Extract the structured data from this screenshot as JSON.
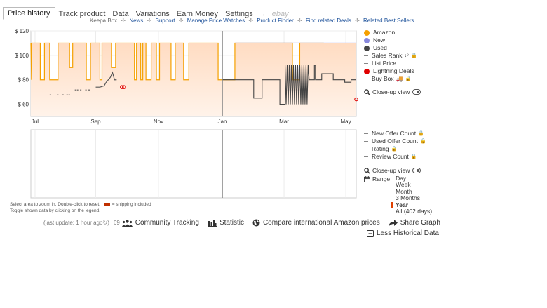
{
  "tabs": [
    "Price history",
    "Track product",
    "Data",
    "Variations",
    "Earn Money",
    "Settings"
  ],
  "tab_arrow": "→",
  "tab_ebay": "ebay",
  "subnav": {
    "brand": "Keepa Box",
    "links": [
      "News",
      "Support",
      "Manage Price Watches",
      "Product Finder",
      "Find related Deals",
      "Related Best Sellers"
    ],
    "separator": "✣"
  },
  "chart_data": [
    {
      "type": "line",
      "y_axis": {
        "ticks": [
          "$ 120",
          "$ 100",
          "$ 80",
          "$ 60"
        ],
        "range": [
          50,
          120
        ]
      },
      "x_axis": {
        "ticks": [
          "Jul",
          "Sep",
          "Nov",
          "Jan",
          "Mar",
          "May"
        ]
      },
      "grid": true,
      "legend_position": "right",
      "series": [
        {
          "name": "Amazon",
          "color": "#f5a000",
          "points": [
            [
              0,
              110
            ],
            [
              0.6,
              80
            ],
            [
              0.8,
              110
            ],
            [
              9,
              110
            ],
            [
              9,
              80
            ],
            [
              13,
              80
            ],
            [
              13,
              110
            ],
            [
              18,
              110
            ],
            [
              18,
              80
            ],
            [
              26,
              80
            ],
            [
              26,
              110
            ],
            [
              37,
              110
            ],
            [
              37,
              90
            ],
            [
              40,
              90
            ],
            [
              40,
              110
            ],
            [
              53,
              110
            ],
            [
              53,
              80
            ],
            [
              57,
              80
            ],
            [
              57,
              110
            ],
            [
              66,
              110
            ],
            [
              66,
              80
            ],
            [
              68,
              80
            ],
            [
              68,
              110
            ],
            [
              77,
              110
            ],
            [
              77,
              90
            ],
            [
              81,
              90
            ],
            [
              81,
              110
            ],
            [
              99,
              110
            ],
            [
              99,
              80
            ],
            [
              101,
              80
            ],
            [
              101,
              110
            ],
            [
              105,
              110
            ],
            [
              105,
              80
            ],
            [
              107,
              80
            ],
            [
              107,
              110
            ],
            [
              110,
              110
            ],
            [
              110,
              80
            ],
            [
              115,
              80
            ],
            [
              115,
              110
            ],
            [
              120,
              110
            ],
            [
              120,
              80
            ],
            [
              123,
              80
            ],
            [
              123,
              110
            ],
            [
              134,
              110
            ],
            [
              134,
              80
            ],
            [
              138,
              80
            ],
            [
              138,
              110
            ],
            [
              146,
              110
            ],
            [
              146,
              80
            ],
            [
              151,
              80
            ],
            [
              151,
              110
            ],
            [
              179,
              110
            ],
            [
              179,
              80
            ],
            [
              195,
              80
            ],
            [
              195,
              110
            ],
            [
              250,
              110
            ],
            [
              250,
              80
            ],
            [
              257,
              80
            ],
            [
              257,
              110
            ],
            [
              280,
              110
            ]
          ]
        },
        {
          "name": "New",
          "color": "#8888dd",
          "points": [
            [
              195,
              110
            ],
            [
              250,
              110
            ],
            [
              257,
              110
            ],
            [
              311,
              110
            ]
          ]
        },
        {
          "name": "Used",
          "color": "#444444",
          "points": [
            [
              183,
              80
            ],
            [
              198,
              80
            ],
            [
              198,
              80
            ],
            [
              213,
              80
            ],
            [
              213,
              65
            ],
            [
              221,
              65
            ],
            [
              221,
              80
            ],
            [
              238,
              80
            ],
            [
              238,
              60
            ],
            [
              243,
              60
            ],
            [
              243,
              92
            ],
            [
              244,
              60
            ],
            [
              245,
              92
            ],
            [
              246,
              60
            ],
            [
              247,
              92
            ],
            [
              248,
              60
            ],
            [
              249,
              92
            ],
            [
              250,
              60
            ],
            [
              251,
              92
            ],
            [
              252,
              60
            ],
            [
              253,
              92
            ],
            [
              254,
              60
            ],
            [
              255,
              92
            ],
            [
              256,
              60
            ],
            [
              257,
              92
            ],
            [
              258,
              60
            ],
            [
              259,
              92
            ],
            [
              260,
              60
            ],
            [
              261,
              92
            ],
            [
              262,
              60
            ],
            [
              263,
              92
            ],
            [
              264,
              60
            ],
            [
              265,
              92
            ],
            [
              266,
              80
            ],
            [
              271,
              80
            ],
            [
              271,
              92
            ],
            [
              272,
              92
            ],
            [
              272,
              80
            ],
            [
              278,
              80
            ],
            [
              278,
              85
            ],
            [
              289,
              85
            ],
            [
              289,
              80
            ],
            [
              300,
              80
            ],
            [
              300,
              78
            ],
            [
              306,
              78
            ],
            [
              306,
              80
            ],
            [
              311,
              80
            ]
          ]
        },
        {
          "name": "Buy Box",
          "color": "#555555",
          "points": [
            [
              62,
              74
            ],
            [
              66,
              74
            ],
            [
              70,
              75
            ],
            [
              72,
              78
            ],
            [
              74,
              80
            ],
            [
              76,
              82
            ],
            [
              77,
              84
            ],
            [
              78,
              86
            ],
            [
              80,
              80
            ],
            [
              82,
              80
            ]
          ]
        },
        {
          "name": "Lightning Deals",
          "color": "#e00000",
          "points": [
            [
              87,
              74
            ],
            [
              89,
              74
            ],
            [
              311,
              64
            ]
          ]
        }
      ]
    },
    {
      "type": "line",
      "x_axis": {
        "ticks": []
      },
      "grid": true,
      "series": []
    }
  ],
  "legend_top": [
    {
      "label": "Amazon",
      "color": "#f5a000",
      "kind": "dot",
      "lock": false,
      "extra": ""
    },
    {
      "label": "New",
      "color": "#8888dd",
      "kind": "dot",
      "lock": false,
      "extra": ""
    },
    {
      "label": "Used",
      "color": "#444444",
      "kind": "dot",
      "lock": false,
      "extra": ""
    },
    {
      "label": "Sales Rank",
      "color": "#888888",
      "kind": "dash",
      "lock": true,
      "extra": "↓⁹"
    },
    {
      "label": "List Price",
      "color": "#888888",
      "kind": "dash",
      "lock": false,
      "extra": ""
    },
    {
      "label": "Lightning Deals",
      "color": "#e00000",
      "kind": "dot",
      "lock": false,
      "extra": ""
    },
    {
      "label": "Buy Box",
      "color": "#888888",
      "kind": "dash",
      "lock": true,
      "extra": "🚚"
    }
  ],
  "closeup_label": "Close-up view",
  "legend_bottom": [
    {
      "label": "New Offer Count",
      "lock": true
    },
    {
      "label": "Used Offer Count",
      "lock": true
    },
    {
      "label": "Rating",
      "lock": true
    },
    {
      "label": "Review Count",
      "lock": true
    }
  ],
  "range": {
    "label": "Range",
    "options": [
      "Day",
      "Week",
      "Month",
      "3 Months",
      "Year",
      "All (402 days)"
    ],
    "selected": "Year"
  },
  "notes": {
    "line1_a": "Select area to zoom in. Double-click to reset.",
    "line1_b": "= shipping included",
    "line2": "Toggle shown data by clicking on the legend."
  },
  "bottom": {
    "last_update": "(last update: 1 hour ago",
    "tracking_count": "69",
    "community": "Community Tracking",
    "statistic": "Statistic",
    "compare": "Compare international Amazon prices",
    "share": "Share Graph",
    "less": "Less Historical Data"
  }
}
